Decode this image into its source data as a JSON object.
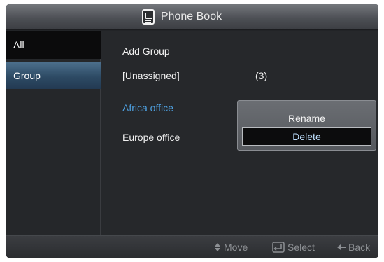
{
  "title_bar": {
    "title": "Phone Book",
    "icon": "phone-book-icon"
  },
  "tabs": [
    {
      "label": "All",
      "selected": false
    },
    {
      "label": "Group",
      "selected": true
    }
  ],
  "groups": [
    {
      "label": "Add Group",
      "count": ""
    },
    {
      "label": "[Unassigned]",
      "count": "(3)"
    },
    {
      "label": "Africa office",
      "count": "",
      "highlighted": true
    },
    {
      "label": "Europe office",
      "count": ""
    }
  ],
  "context_menu": {
    "rename": "Rename",
    "delete": "Delete",
    "selected": "Delete"
  },
  "hints": {
    "move": {
      "label": "Move",
      "icon": "up-down-arrows-icon"
    },
    "select": {
      "label": "Select",
      "icon": "enter-key-icon"
    },
    "back": {
      "label": "Back",
      "icon": "left-arrow-icon"
    }
  },
  "colors": {
    "highlight_text": "#4ea0e0",
    "selected_tab": "#2d4a64"
  }
}
